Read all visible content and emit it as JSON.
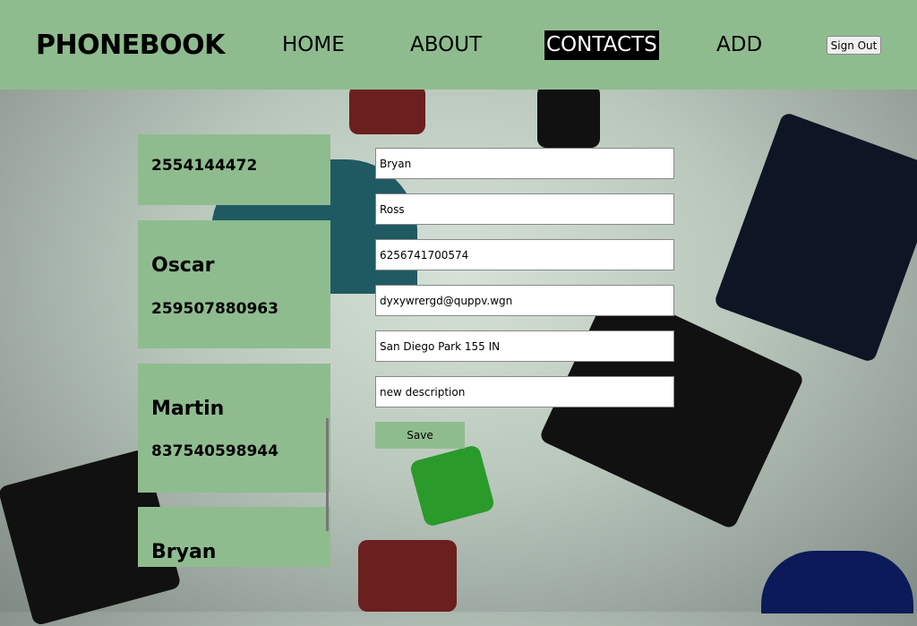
{
  "header": {
    "logo": "PHONEBOOK",
    "nav": [
      "HOME",
      "ABOUT",
      "CONTACTS",
      "ADD"
    ],
    "active": "CONTACTS",
    "sign_out": "Sign Out"
  },
  "contacts": [
    {
      "phone": "2554144472"
    },
    {
      "name": "Oscar",
      "phone": "259507880963"
    },
    {
      "name": "Martin",
      "phone": "837540598944"
    },
    {
      "name": "Bryan"
    }
  ],
  "form": {
    "first_name": "Bryan",
    "last_name": "Ross",
    "phone": "6256741700574",
    "email": "dyxywrergd@quppv.wgn",
    "address": "San Diego Park 155 IN",
    "description": "new description",
    "save_label": "Save"
  }
}
